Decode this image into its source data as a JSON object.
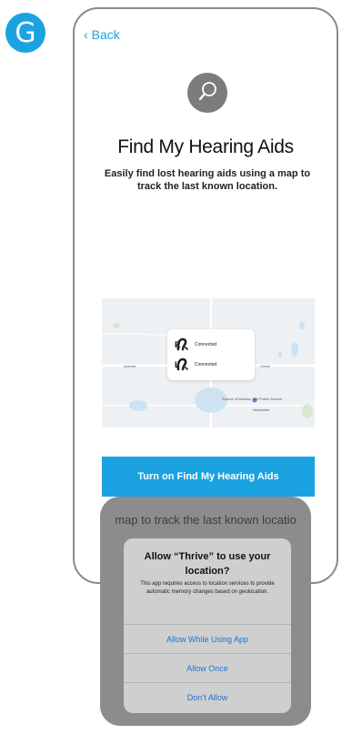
{
  "step_badge": "G",
  "nav": {
    "back_label": "Back"
  },
  "header": {
    "title": "Find My Hearing Aids",
    "subtitle": "Easily find lost hearing aids using a map to track the last known location."
  },
  "map": {
    "devices": [
      {
        "side": "R",
        "status": "Connected"
      },
      {
        "side": "L",
        "status": "Connected"
      }
    ],
    "labels": [
      "Avenue",
      "Creek",
      "Source of Medina, MN Public Service",
      "Nearwater"
    ]
  },
  "cta_label": "Turn on Find My Hearing Aids",
  "behind_text": "map to track the last known locatio",
  "permission_dialog": {
    "title": "Allow “Thrive” to use your location?",
    "message": "This app requires access to location services to provide automatic memory changes based on geolocation.",
    "buttons": [
      "Allow While Using App",
      "Allow Once",
      "Don’t Allow"
    ]
  },
  "colors": {
    "accent": "#1aa3e0",
    "ios_blue": "#1a73d6",
    "dim": "#8c8c8c"
  },
  "icons": {
    "badge": "step-g",
    "hero": "search-icon",
    "hearing": "hearing-aid-icon"
  }
}
